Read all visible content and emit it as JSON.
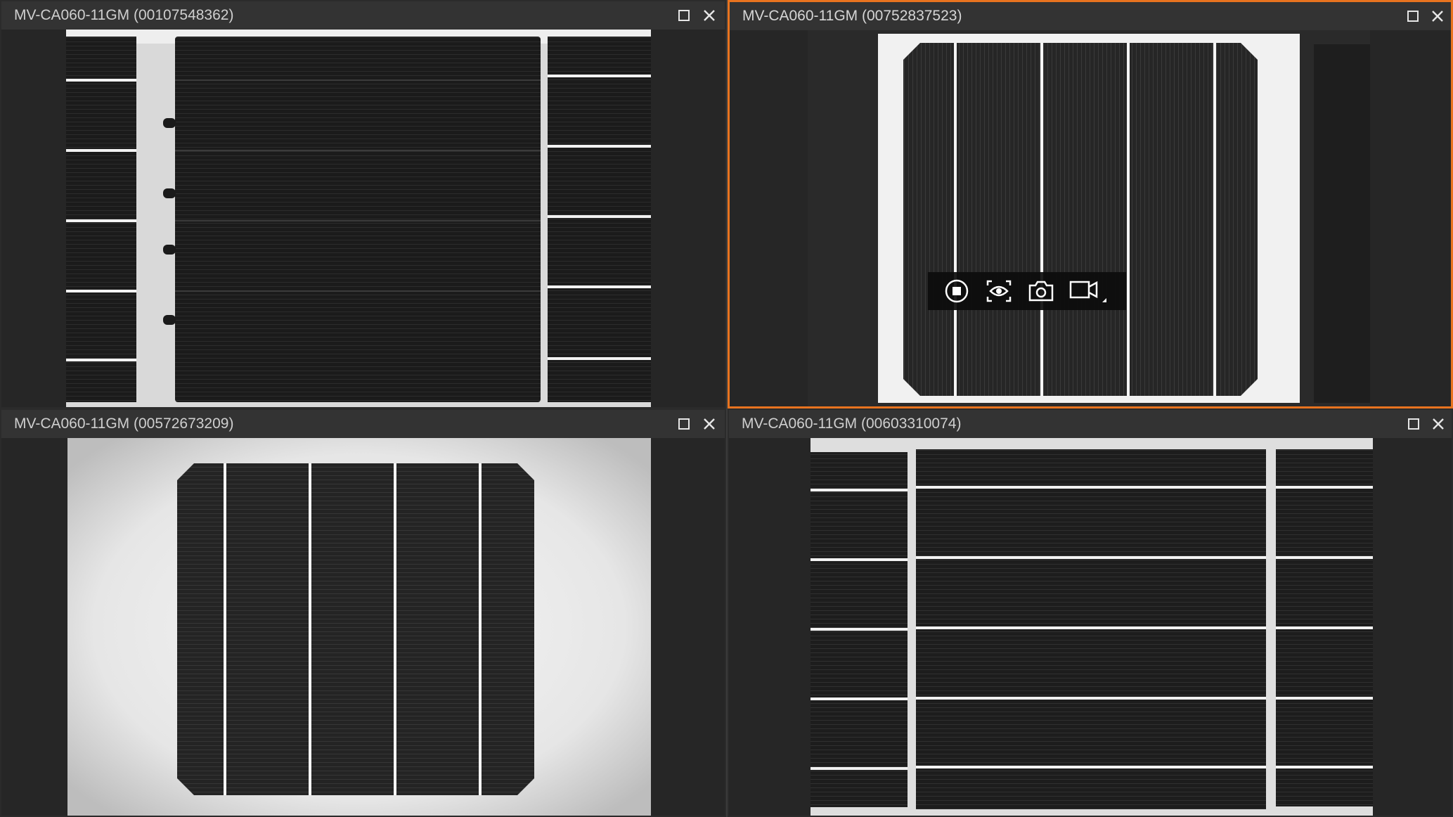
{
  "panes": [
    {
      "title": "MV-CA060-11GM (00107548362)",
      "active": false
    },
    {
      "title": "MV-CA060-11GM (00752837523)",
      "active": true
    },
    {
      "title": "MV-CA060-11GM (00572673209)",
      "active": false
    },
    {
      "title": "MV-CA060-11GM (00603310074)",
      "active": false
    }
  ],
  "toolbar": {
    "buttons": [
      "stop-icon",
      "preview-eye-icon",
      "camera-snapshot-icon",
      "video-record-icon"
    ]
  },
  "colors": {
    "active_border": "#e8731f",
    "header_bg": "#333333",
    "pane_bg": "#262626"
  }
}
